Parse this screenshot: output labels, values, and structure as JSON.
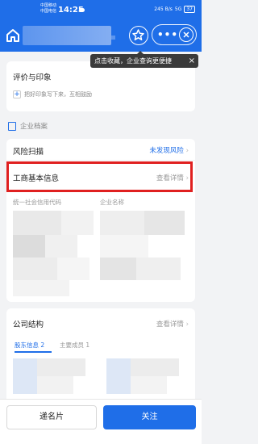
{
  "status_bar": {
    "carrier_1": "中国移动",
    "carrier_2": "中国电信",
    "time": "14:25",
    "network": "245 B/s",
    "signal": "5G",
    "battery": "37"
  },
  "header": {
    "home_icon": "home-icon",
    "star_icon": "star-icon",
    "more_icon": "more-icon",
    "close_icon": "close-icon"
  },
  "tooltip": {
    "text": "点击收藏，企业查询更便捷",
    "close": "×"
  },
  "review": {
    "title": "评价与印象",
    "hint": "把好印象写下来，互相鼓励"
  },
  "archive": {
    "label": "企业档案"
  },
  "risk": {
    "title": "风险扫描",
    "status": "未发现风险"
  },
  "business_info": {
    "title": "工商基本信息",
    "link": "查看详情",
    "col_1": "统一社会信用代码",
    "col_2": "企业名称"
  },
  "structure": {
    "title": "公司结构",
    "link": "查看详情",
    "tab_1_label": "股东信息",
    "tab_1_count": "2",
    "tab_2_label": "主要成员",
    "tab_2_count": "1"
  },
  "bottom_bar": {
    "card_button": "递名片",
    "follow_button": "关注"
  },
  "colors": {
    "brand": "#1f6ee8",
    "highlight": "#e02020"
  }
}
